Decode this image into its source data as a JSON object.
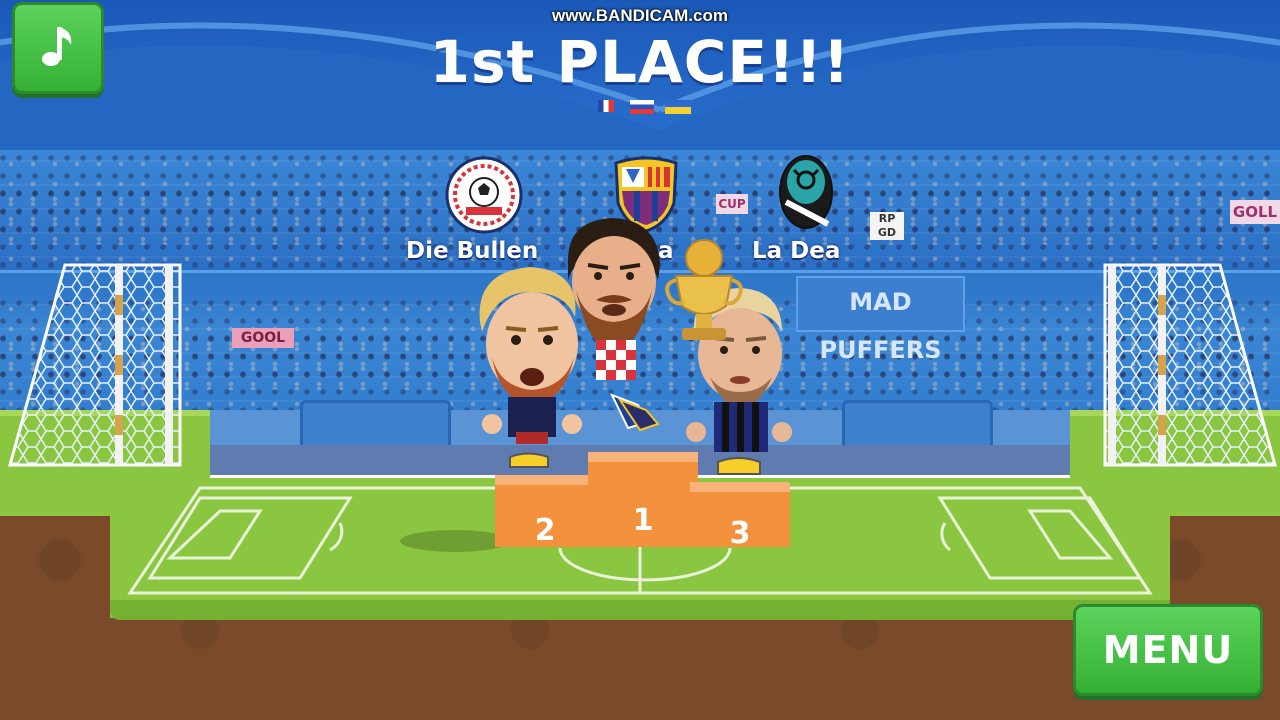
{
  "watermark": "www.BANDICAM.com",
  "title": "1st PLACE!!!",
  "music_button": {
    "icon": "music-note-icon"
  },
  "menu_button": {
    "label": "MENU"
  },
  "podium": {
    "teams": [
      {
        "place": "2",
        "name": "Die Bullen",
        "crest": "die-bullen-crest"
      },
      {
        "place": "1",
        "name": "Barca",
        "crest": "barca-crest"
      },
      {
        "place": "3",
        "name": "La Dea",
        "crest": "la-dea-crest"
      }
    ]
  },
  "stadium_signs": {
    "mad_puffers": "MAD PUFFERS",
    "gool_left": "GOOL",
    "goll_right": "GOLL",
    "cup": "CUP",
    "rpgd": "RP GD"
  },
  "colors": {
    "button_green": "#35b034",
    "podium_orange": "#f3913d",
    "grass": "#8bc640",
    "sky": "#1b59b8"
  }
}
